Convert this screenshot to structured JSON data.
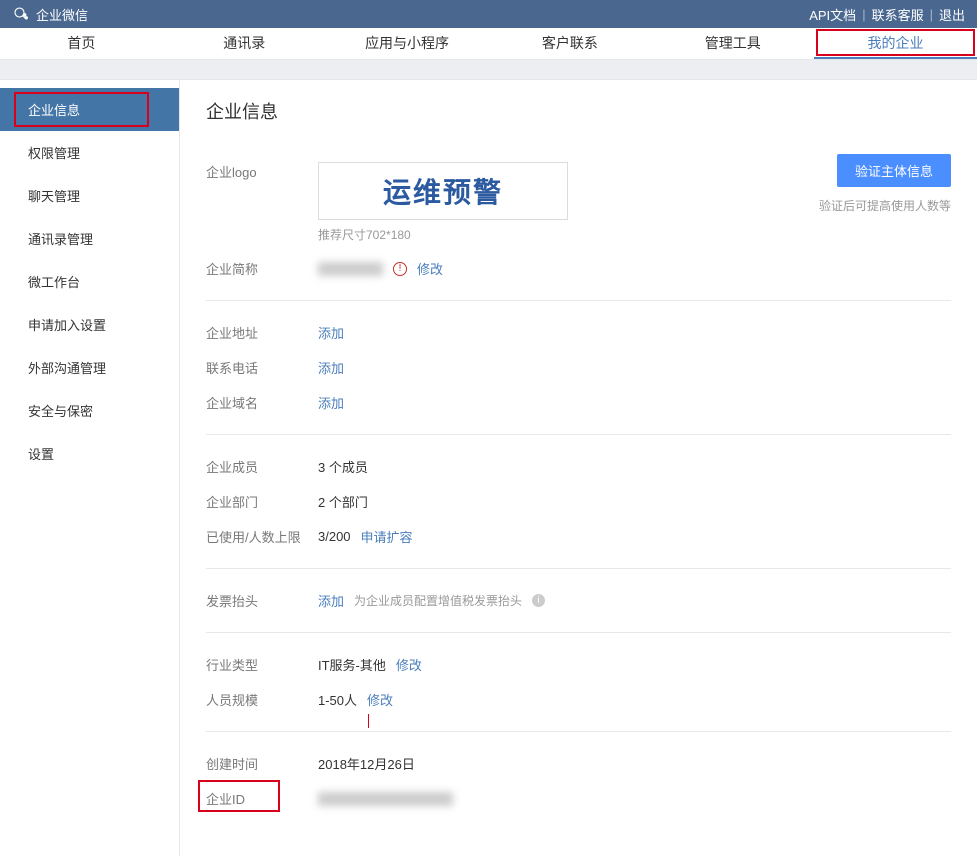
{
  "header": {
    "brand": "企业微信",
    "links": {
      "api_doc": "API文档",
      "contact": "联系客服",
      "logout": "退出"
    }
  },
  "nav": [
    {
      "label": "首页",
      "active": false
    },
    {
      "label": "通讯录",
      "active": false
    },
    {
      "label": "应用与小程序",
      "active": false
    },
    {
      "label": "客户联系",
      "active": false
    },
    {
      "label": "管理工具",
      "active": false
    },
    {
      "label": "我的企业",
      "active": true,
      "highlighted": true
    }
  ],
  "sidebar": [
    {
      "label": "企业信息",
      "active": true,
      "highlighted": true
    },
    {
      "label": "权限管理"
    },
    {
      "label": "聊天管理"
    },
    {
      "label": "通讯录管理"
    },
    {
      "label": "微工作台"
    },
    {
      "label": "申请加入设置"
    },
    {
      "label": "外部沟通管理"
    },
    {
      "label": "安全与保密"
    },
    {
      "label": "设置"
    }
  ],
  "page": {
    "title": "企业信息",
    "logo": {
      "label": "企业logo",
      "text": "运维预警",
      "hint": "推荐尺寸702*180"
    },
    "shortname": {
      "label": "企业简称",
      "action": "修改"
    },
    "verify": {
      "button": "验证主体信息",
      "hint": "验证后可提高使用人数等"
    },
    "fields": {
      "address": {
        "label": "企业地址",
        "action": "添加"
      },
      "phone": {
        "label": "联系电话",
        "action": "添加"
      },
      "domain": {
        "label": "企业域名",
        "action": "添加"
      }
    },
    "stats": {
      "members": {
        "label": "企业成员",
        "value": "3 个成员"
      },
      "depts": {
        "label": "企业部门",
        "value": "2 个部门"
      },
      "used": {
        "label": "已使用/人数上限",
        "value": "3/200",
        "action": "申请扩容"
      }
    },
    "invoice": {
      "label": "发票抬头",
      "action": "添加",
      "hint": "为企业成员配置增值税发票抬头"
    },
    "industry": {
      "label": "行业类型",
      "value": "IT服务-其他",
      "action": "修改"
    },
    "scale": {
      "label": "人员规模",
      "value": "1-50人",
      "action": "修改"
    },
    "created": {
      "label": "创建时间",
      "value": "2018年12月26日"
    },
    "corpid": {
      "label": "企业ID"
    }
  }
}
